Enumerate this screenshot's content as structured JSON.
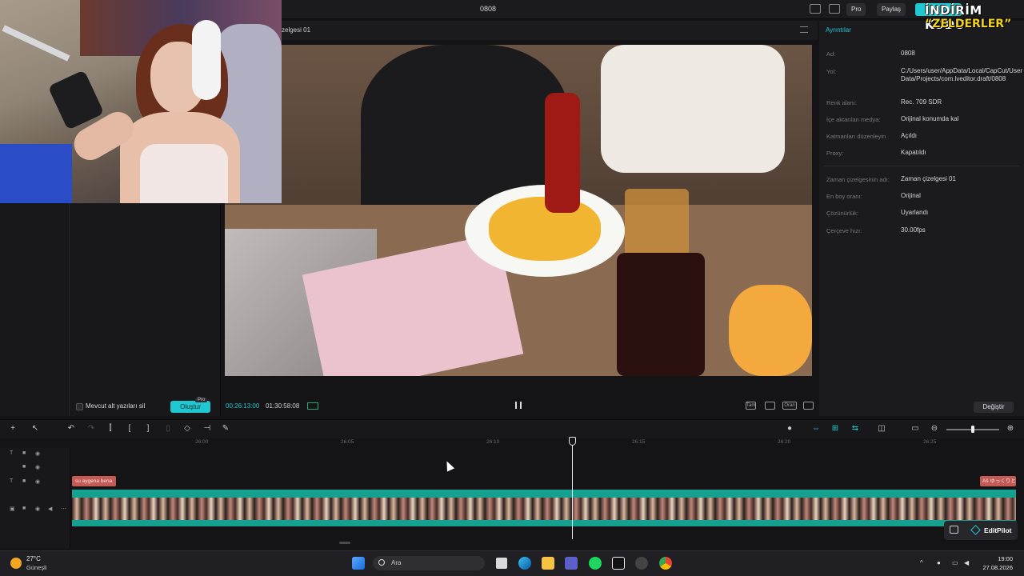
{
  "app": {
    "title": "0808",
    "pro_label": "Pro",
    "share_label": "Paylaş"
  },
  "promo": {
    "line1": "İNDİRİM KODU",
    "line2": "“ZELDERLER”"
  },
  "left_panel": {
    "delete_label": "Mevcut alt yazıları sil",
    "create_label": "Oluştur",
    "pro_tag": "Pro"
  },
  "player": {
    "title": "zelgesi 01",
    "time_current": "00:26:13:00",
    "time_total": "01:30:58:08",
    "icons": [
      "Tam",
      "fit-icon",
      "Oran",
      "fullscreen-icon"
    ]
  },
  "details": {
    "title": "Ayrıntılar",
    "rows": [
      {
        "key": "Ad:",
        "value": "0808"
      },
      {
        "key": "Yol:",
        "value": "C:/Users/user/AppData/Local/CapCut/User Data/Projects/com.lveditor.draft/0808"
      },
      {
        "key": "Renk alanı:",
        "value": "Rec. 709 SDR"
      },
      {
        "key": "İçe aktarılan medya:",
        "value": "Orijinal konumda kal"
      },
      {
        "key": "Katmanları düzenleyin",
        "value": "Açıldı"
      },
      {
        "key": "Proxy:",
        "value": "Kapatıldı"
      },
      {
        "key": "Zaman çizelgesinin adı:",
        "value": "Zaman çizelgesi 01"
      },
      {
        "key": "En boy oranı:",
        "value": "Orijinal"
      },
      {
        "key": "Çözünürlük:",
        "value": "Uyarlandı"
      },
      {
        "key": "Çerçeve hızı:",
        "value": "30.00fps"
      }
    ],
    "change_label": "Değiştir"
  },
  "timeline": {
    "ticks": [
      "26:00",
      "26:05",
      "26:10",
      "26:15",
      "26:20",
      "26:25"
    ],
    "clip_left": "su aygena bena",
    "clip_right": "Aš ゆっくりと",
    "editpilot_label": "EditPilot"
  },
  "taskbar": {
    "weather_temp": "27°C",
    "weather_desc": "Güneşli",
    "search_placeholder": "Ara",
    "time": "19:00",
    "date": "27.08.2026"
  }
}
